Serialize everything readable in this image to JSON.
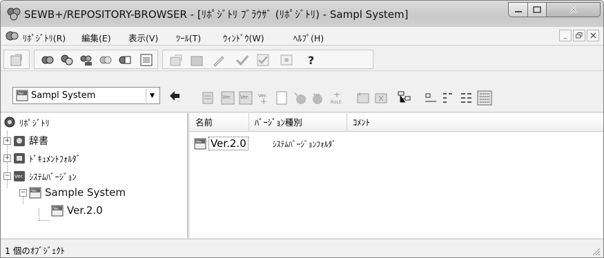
{
  "window": {
    "title": "SEWB+/REPOSITORY-BROWSER - [ﾘﾎﾟｼﾞﾄﾘ ﾌﾞﾗｳｻﾞ (ﾘﾎﾟｼﾞﾄﾘ) - Sampl System]"
  },
  "menu": {
    "items": [
      "ﾘﾎﾟｼﾞﾄﾘ(R)",
      "編集(E)",
      "表示(V)",
      "ﾂｰﾙ(T)",
      "ｳｨﾝﾄﾞｳ(W)",
      "ﾍﾙﾌﾟ(H)"
    ]
  },
  "toolbar": {
    "combo_value": "Sampl System"
  },
  "tree": {
    "root": "ﾘﾎﾟｼﾞﾄﾘ",
    "dictionary": "辞書",
    "document_folder": "ﾄﾞｷｭﾒﾝﾄﾌｫﾙﾀﾞ",
    "system_version": "ｼｽﾃﾑﾊﾞｰｼﾞｮﾝ",
    "sample_system": "Sample System",
    "version": "Ver.2.0"
  },
  "list": {
    "columns": [
      "名前",
      "ﾊﾞｰｼﾞｮﾝ種別",
      "ｺﾒﾝﾄ"
    ],
    "rows": [
      {
        "name": "Ver.2.0",
        "type": "ｼｽﾃﾑﾊﾞｰｼﾞｮﾝﾌｫﾙﾀﾞ",
        "comment": ""
      }
    ]
  },
  "status": {
    "text": "1 個のｵﾌﾞｼﾞｪｸﾄ"
  },
  "icons": {
    "version_badge": "Ver."
  }
}
